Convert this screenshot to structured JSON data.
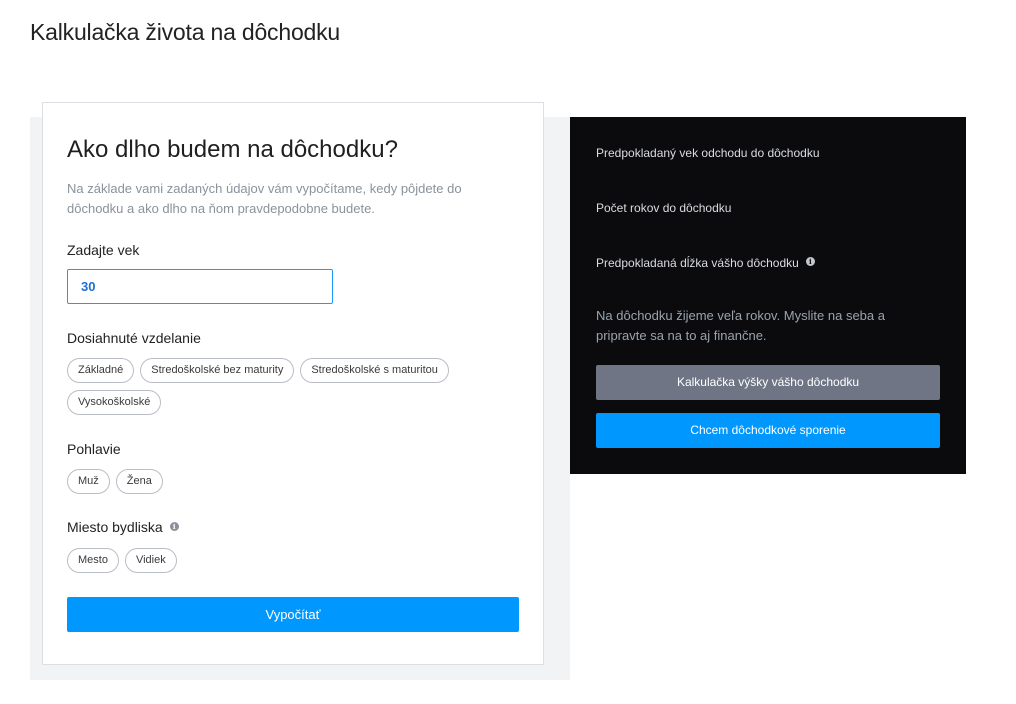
{
  "page": {
    "title": "Kalkulačka života na dôchodku"
  },
  "form": {
    "title": "Ako dlho budem na dôchodku?",
    "description": "Na základe vami zadaných údajov vám vypočítame, kedy pôjdete do dôchodku a ako dlho na ňom pravdepodobne budete.",
    "age": {
      "label": "Zadajte vek",
      "value": "30"
    },
    "education": {
      "label": "Dosiahnuté vzdelanie",
      "options": [
        "Základné",
        "Stredoškolské bez maturity",
        "Stredoškolské s maturitou",
        "Vysokoškolské"
      ]
    },
    "gender": {
      "label": "Pohlavie",
      "options": [
        "Muž",
        "Žena"
      ]
    },
    "residence": {
      "label": "Miesto bydliska",
      "info_icon": "info-icon",
      "options": [
        "Mesto",
        "Vidiek"
      ]
    },
    "submit_label": "Vypočítať"
  },
  "results": {
    "retirement_age_label": "Predpokladaný vek odchodu do dôchodku",
    "years_to_retirement_label": "Počet rokov do dôchodku",
    "retirement_length_label": "Predpokladaná dĺžka vášho dôchodku",
    "retirement_length_info_icon": "info-icon",
    "note": "Na dôchodku žijeme veľa rokov. Myslite na seba a pripravte sa na to aj finančne.",
    "pension_calc_button": "Kalkulačka výšky vášho dôchodku",
    "savings_button": "Chcem dôchodkové sporenie"
  },
  "colors": {
    "accent": "#0098ff",
    "panel_bg": "#0b0b0d",
    "secondary_button": "#6f7585"
  }
}
